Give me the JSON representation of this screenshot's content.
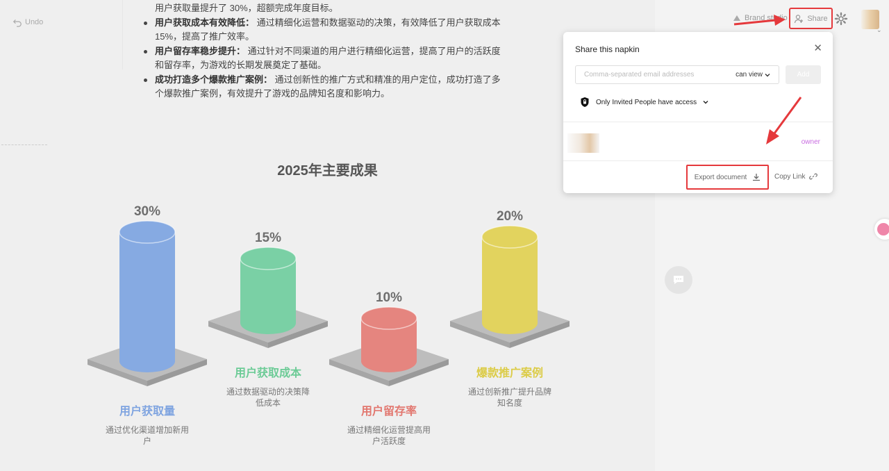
{
  "toolbar": {
    "undo_label": "Undo",
    "brand_label": "Brand studio",
    "share_label": "Share"
  },
  "doc": {
    "lines": [
      {
        "bold": "",
        "text": "用户获取量提升了 30%，超额完成年度目标。",
        "bullet": false
      },
      {
        "bold": "用户获取成本有效降低：",
        "text": " 通过精细化运营和数据驱动的决策，有效降低了用户获取成本",
        "bullet": true
      },
      {
        "bold": "",
        "text": "15%，提高了推广效率。",
        "bullet": false
      },
      {
        "bold": "用户留存率稳步提升：",
        "text": " 通过针对不同渠道的用户进行精细化运营，提高了用户的活跃度",
        "bullet": true
      },
      {
        "bold": "",
        "text": "和留存率，为游戏的长期发展奠定了基础。",
        "bullet": false
      },
      {
        "bold": "成功打造多个爆款推广案例：",
        "text": " 通过创新性的推广方式和精准的用户定位，成功打造了多",
        "bullet": true
      },
      {
        "bold": "",
        "text": "个爆款推广案例，有效提升了游戏的品牌知名度和影响力。",
        "bullet": false
      }
    ]
  },
  "chart_data": {
    "type": "bar",
    "title": "2025年主要成果",
    "categories": [
      "用户获取量",
      "用户获取成本",
      "用户留存率",
      "爆款推广案例"
    ],
    "values": [
      30,
      15,
      10,
      20
    ],
    "value_labels": [
      "30%",
      "15%",
      "10%",
      "20%"
    ],
    "descriptions": [
      [
        "通过优化渠道增加新用",
        "户"
      ],
      [
        "通过数据驱动的决策降",
        "低成本"
      ],
      [
        "通过精细化运营提高用",
        "户活跃度"
      ],
      [
        "通过创新推广提升品牌",
        "知名度"
      ]
    ],
    "colors": [
      "#86aae2",
      "#7ad0a5",
      "#e5857f",
      "#e2d35e"
    ],
    "label_colors": [
      "#7fa4e0",
      "#6ccb96",
      "#e2776f",
      "#dccc48"
    ],
    "unit": "%"
  },
  "share_modal": {
    "title": "Share this napkin",
    "email_placeholder": "Comma-separated email addresses",
    "permission": "can view",
    "add_label": "Add",
    "access_label": "Only Invited People have access",
    "member_role": "owner",
    "export_label": "Export document",
    "copy_link_label": "Copy Link"
  },
  "colors": {
    "highlight": "#e5393c",
    "owner_role": "#c86be0"
  },
  "icons": [
    "undo-icon",
    "brand-icon",
    "add-person-icon",
    "gear-icon",
    "close-icon",
    "chevron-down-icon",
    "lock-icon",
    "download-icon",
    "link-icon",
    "chat-icon"
  ]
}
